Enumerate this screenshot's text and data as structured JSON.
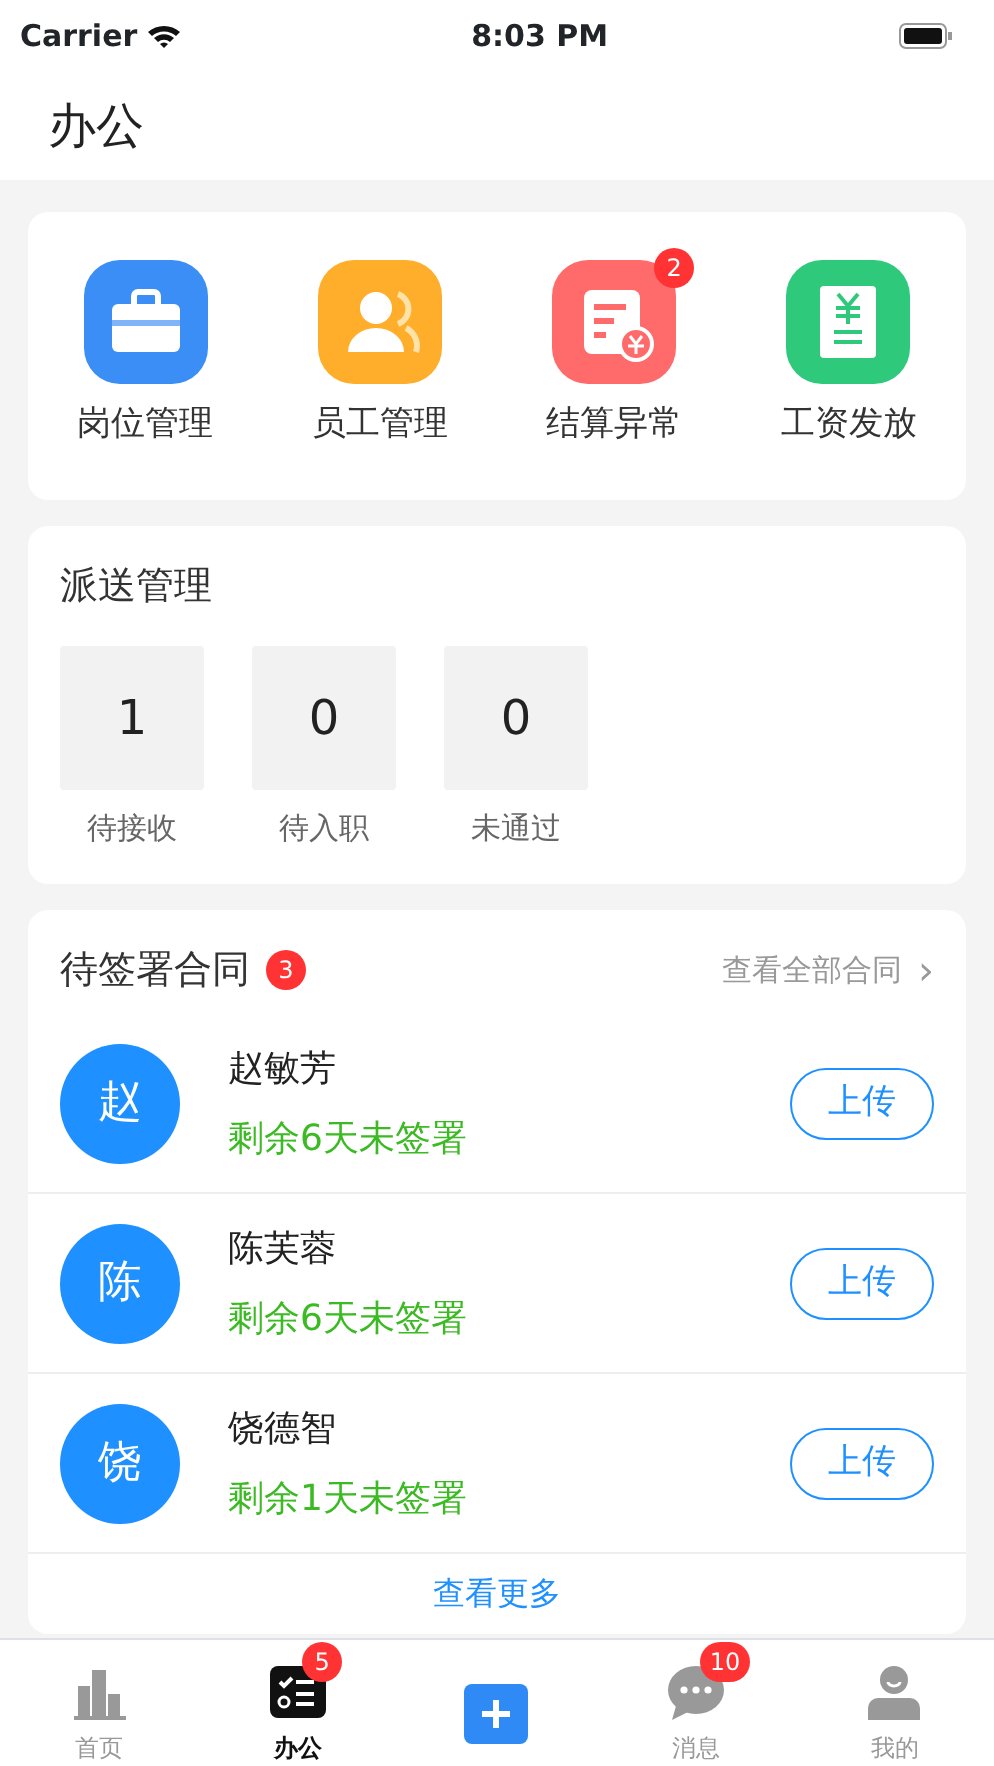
{
  "status_bar": {
    "carrier": "Carrier",
    "time": "8:03 PM"
  },
  "header": {
    "title": "办公"
  },
  "shortcuts": [
    {
      "kind": "briefcase",
      "label": "岗位管理",
      "color": "#3a8ef6"
    },
    {
      "kind": "people",
      "label": "员工管理",
      "color": "#ffae2b"
    },
    {
      "kind": "bill",
      "label": "结算异常",
      "color": "#ff6b6b",
      "badge": "2"
    },
    {
      "kind": "salary",
      "label": "工资发放",
      "color": "#2ec97a"
    }
  ],
  "dispatch": {
    "title": "派送管理",
    "stats": [
      {
        "value": "1",
        "label": "待接收"
      },
      {
        "value": "0",
        "label": "待入职"
      },
      {
        "value": "0",
        "label": "未通过"
      }
    ]
  },
  "contracts": {
    "title": "待签署合同",
    "badge": "3",
    "view_all": "查看全部合同",
    "chevron": "›",
    "items": [
      {
        "avatar": "赵",
        "name": "赵敏芳",
        "remaining": "剩余6天未签署",
        "action": "上传"
      },
      {
        "avatar": "陈",
        "name": "陈芙蓉",
        "remaining": "剩余6天未签署",
        "action": "上传"
      },
      {
        "avatar": "饶",
        "name": "饶德智",
        "remaining": "剩余1天未签署",
        "action": "上传"
      }
    ],
    "more": "查看更多"
  },
  "tab_bar": [
    {
      "kind": "chart",
      "label": "首页",
      "selected": false
    },
    {
      "kind": "tasks",
      "label": "办公",
      "selected": true,
      "badge": "5"
    },
    {
      "kind": "add",
      "selected": false
    },
    {
      "kind": "chat",
      "label": "消息",
      "selected": false,
      "badge": "10"
    },
    {
      "kind": "person",
      "label": "我的",
      "selected": false
    }
  ]
}
